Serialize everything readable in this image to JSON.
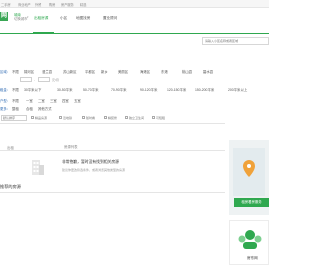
{
  "topbar": {
    "links": [
      "二手房",
      "商业地产",
      "外贸",
      "购房",
      "房产服务",
      "精选"
    ]
  },
  "header": {
    "logo_text": "网",
    "city_name": "城南",
    "city_switch": "切换城市",
    "tabs": [
      "出租房源",
      "小区",
      "地图找房",
      "置业顾问"
    ],
    "active_tab": 0,
    "search_placeholder": "请输入小区名称或者区域"
  },
  "filters": {
    "region": {
      "label": "区域：",
      "options": [
        "不限",
        "锦河区",
        "漫兰县",
        "苏山新区",
        "平都区",
        "新乡",
        "美丽区",
        "海港区",
        "东港",
        "桃山县",
        "碧水县"
      ]
    },
    "rent": {
      "label": "租金：",
      "options": [
        "不限",
        "30平米以下",
        "30-50平米",
        "50-70平米",
        "70-90平米",
        "90-120平米",
        "120-150平米",
        "150-200平米",
        "200平米以上"
      ]
    },
    "type": {
      "label": "户型：",
      "options": [
        "不限",
        "一室",
        "二室",
        "三室",
        "四室",
        "五室"
      ]
    },
    "more": {
      "label": "更多：",
      "options": [
        "整租",
        "合租",
        "其他方式"
      ]
    },
    "price_sep": "-",
    "price_unit": "元/月"
  },
  "sort": {
    "select_value": "默认排序",
    "checkboxes": [
      "精品房源",
      "近地铁",
      "随时看",
      "精装修",
      "独立卫生间",
      "可短租"
    ]
  },
  "breadcrumb": {
    "left": "出租",
    "right": "房源列表"
  },
  "empty_state": {
    "title": "非常抱歉，暂时没有找到相关房源",
    "subtitle": "建议你更改筛选条件，或者浏览其他类型的房源"
  },
  "recommend_title": "推荐的房源",
  "ad": {
    "button": "租房看房服务",
    "card2_text": "房东网"
  },
  "colors": {
    "brand": "#2fa84f",
    "link_blue": "#2f6bb3",
    "empty_text": "#999999"
  }
}
